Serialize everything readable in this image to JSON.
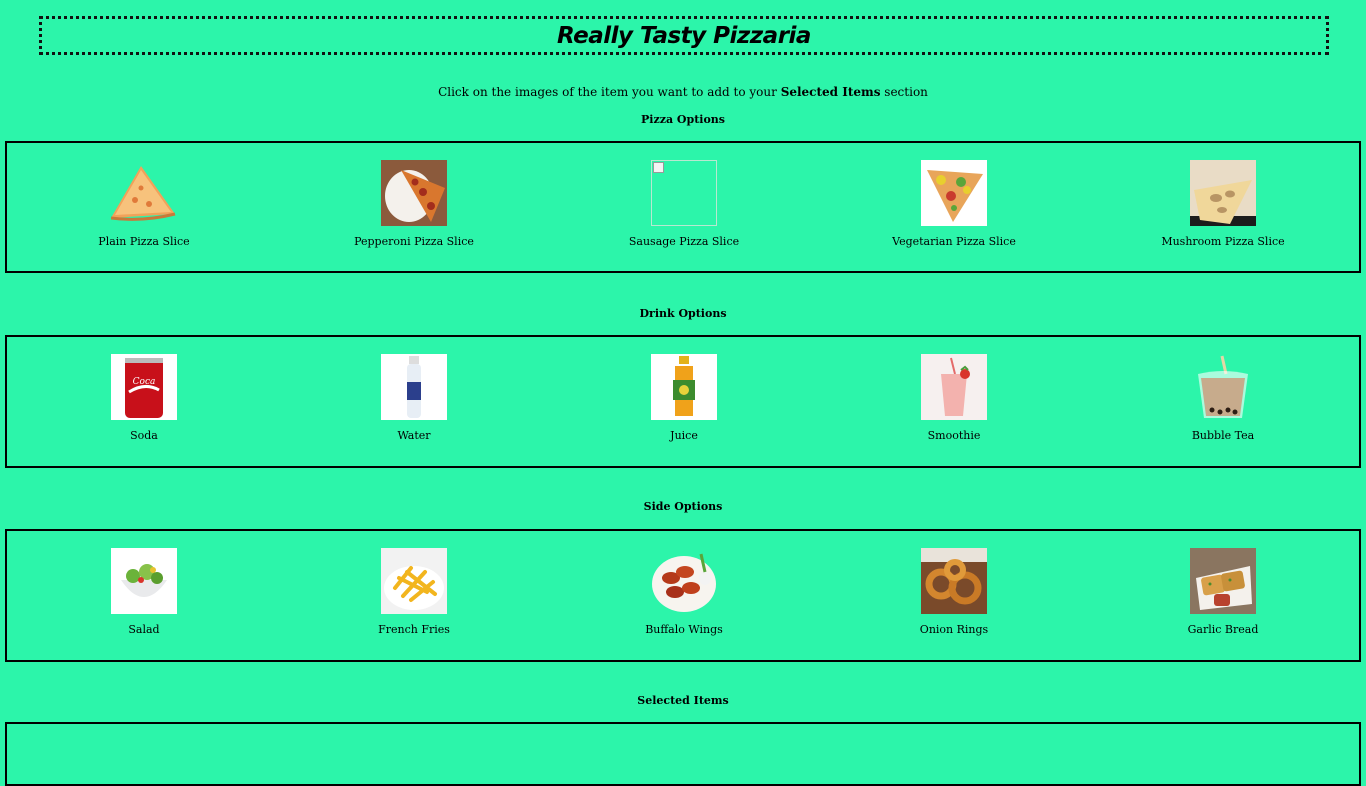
{
  "header": {
    "title": "Really Tasty Pizzaria"
  },
  "instructions": {
    "before": "Click on the images of the item you want to add to your ",
    "emphasis": "Selected Items",
    "after": " section"
  },
  "pizza": {
    "title": "Pizza Options",
    "items": [
      {
        "label": "Plain Pizza Slice",
        "icon": "plain-pizza-image"
      },
      {
        "label": "Pepperoni Pizza Slice",
        "icon": "pepperoni-pizza-image"
      },
      {
        "label": "Sausage Pizza Slice",
        "icon": "broken-image"
      },
      {
        "label": "Vegetarian Pizza Slice",
        "icon": "vegetarian-pizza-image"
      },
      {
        "label": "Mushroom Pizza Slice",
        "icon": "mushroom-pizza-image"
      }
    ]
  },
  "drinks": {
    "title": "Drink Options",
    "items": [
      {
        "label": "Soda",
        "icon": "soda-can-image"
      },
      {
        "label": "Water",
        "icon": "water-bottle-image"
      },
      {
        "label": "Juice",
        "icon": "juice-bottle-image"
      },
      {
        "label": "Smoothie",
        "icon": "smoothie-image"
      },
      {
        "label": "Bubble Tea",
        "icon": "bubble-tea-image"
      }
    ]
  },
  "sides": {
    "title": "Side Options",
    "items": [
      {
        "label": "Salad",
        "icon": "salad-image"
      },
      {
        "label": "French Fries",
        "icon": "french-fries-image"
      },
      {
        "label": "Buffalo Wings",
        "icon": "buffalo-wings-image"
      },
      {
        "label": "Onion Rings",
        "icon": "onion-rings-image"
      },
      {
        "label": "Garlic Bread",
        "icon": "garlic-bread-image"
      }
    ]
  },
  "selected": {
    "title": "Selected Items"
  }
}
